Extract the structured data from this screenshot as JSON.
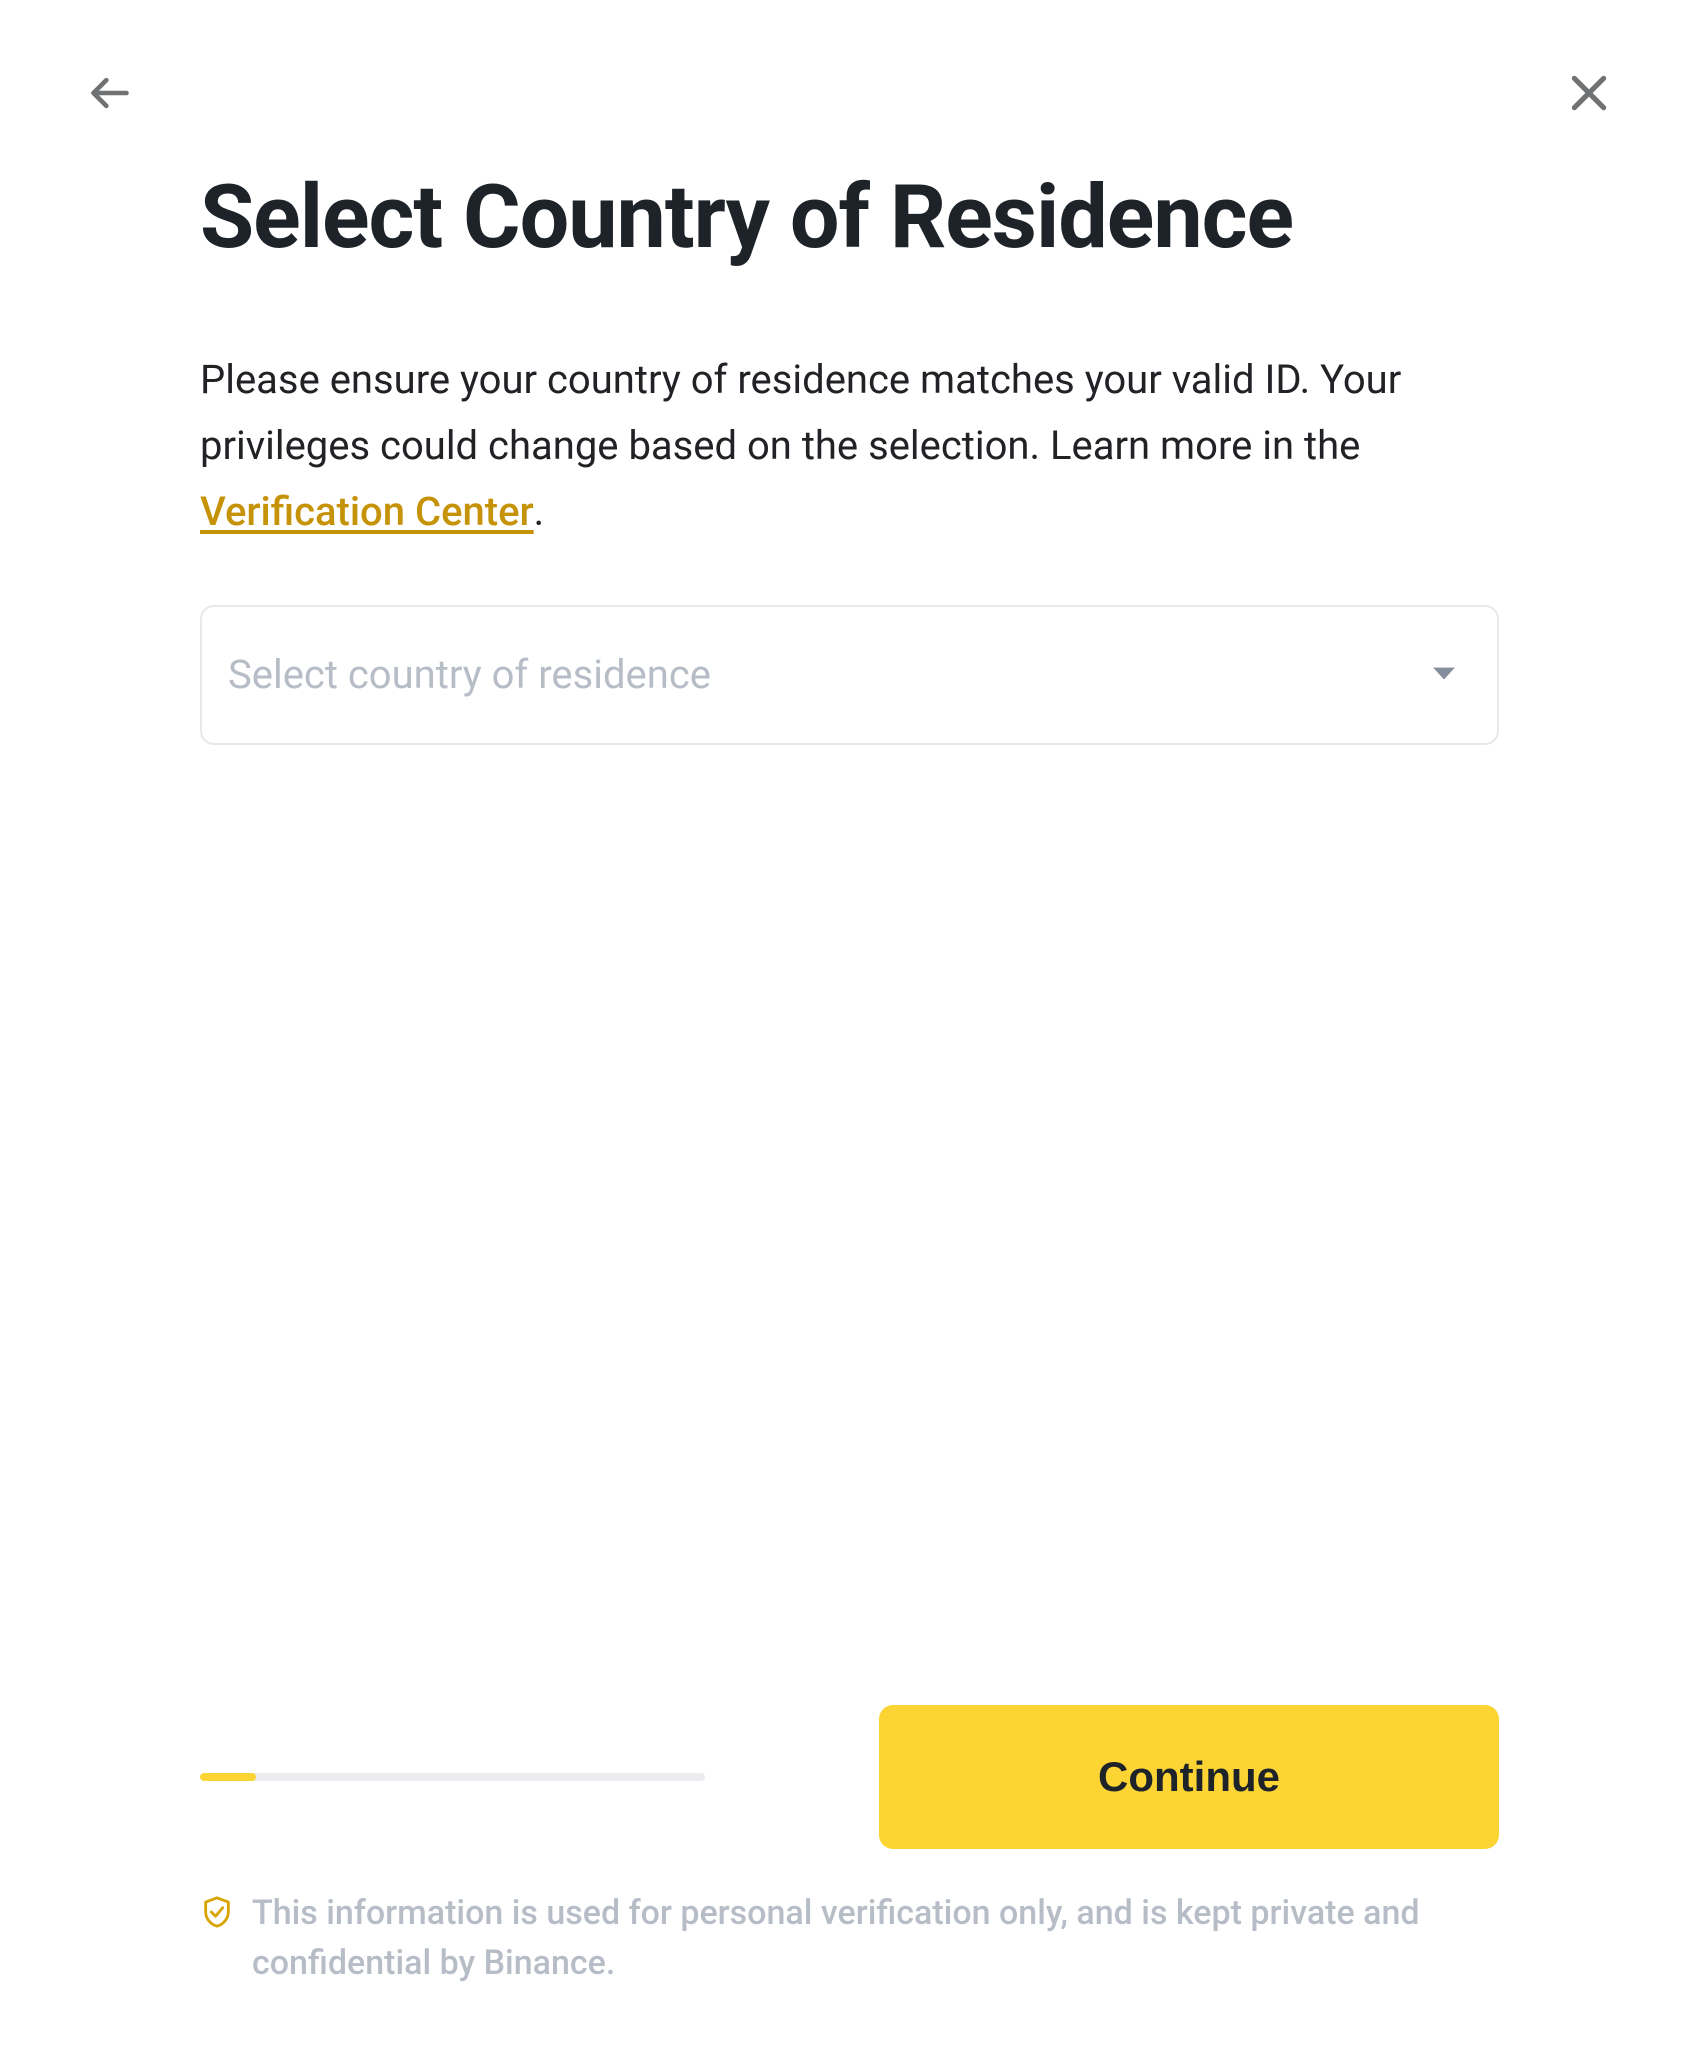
{
  "title": "Select Country of Residence",
  "subtitle_part1": "Please ensure your country of residence matches your valid ID. Your privileges could change based on the selection. Learn more in the ",
  "subtitle_link": "Verification Center",
  "subtitle_part2": ".",
  "select": {
    "placeholder": "Select country of residence"
  },
  "continue_label": "Continue",
  "disclaimer": "This information is used for personal verification only, and is kept private and confidential by Binance.",
  "progress_percent": 11
}
